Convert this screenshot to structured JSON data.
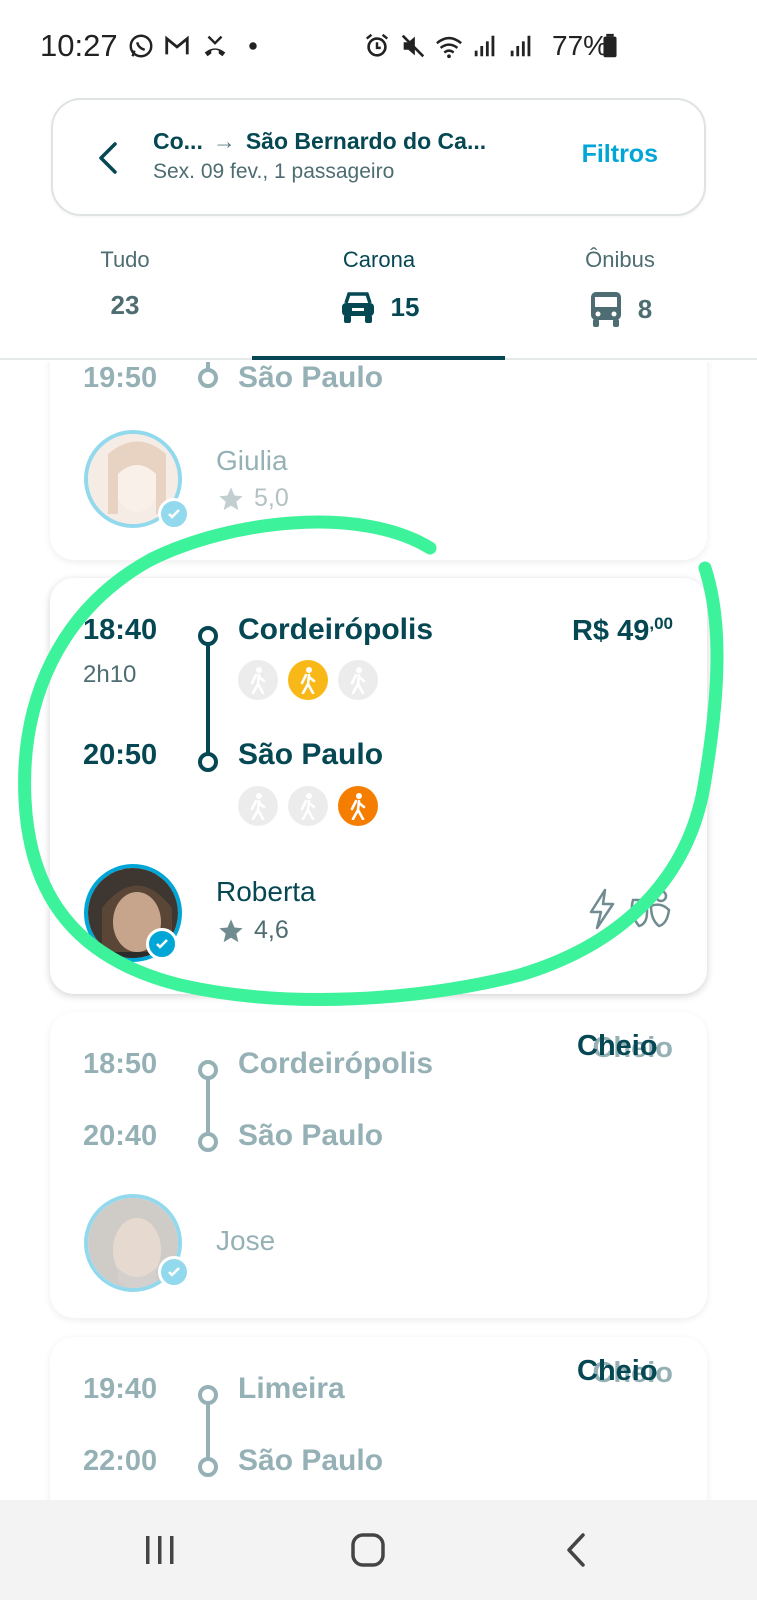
{
  "status_bar": {
    "time": "10:27",
    "battery": "77%",
    "icons": [
      "whatsapp-icon",
      "gmail-icon",
      "missed-call-icon",
      "notification-dot-icon",
      "alarm-icon",
      "mute-icon",
      "wifi-icon",
      "signal-icon",
      "signal-icon",
      "battery-icon"
    ]
  },
  "search": {
    "origin": "Co...",
    "destination": "São Bernardo do Ca...",
    "subtitle": "Sex. 09 fev., 1 passageiro",
    "filters_label": "Filtros"
  },
  "tabs": [
    {
      "label": "Tudo",
      "count": "23",
      "icon": ""
    },
    {
      "label": "Carona",
      "count": "15",
      "icon": "car-icon",
      "active": true
    },
    {
      "label": "Ônibus",
      "count": "8",
      "icon": "bus-icon"
    }
  ],
  "rides": [
    {
      "arrival_time": "19:50",
      "arrival_city": "São Paulo",
      "driver": "Giulia",
      "rating": "5,0",
      "status": "faded"
    },
    {
      "departure_time": "18:40",
      "duration": "2h10",
      "departure_city": "Cordeirópolis",
      "arrival_time": "20:50",
      "arrival_city": "São Paulo",
      "price_main": "R$ 49",
      "price_cents": ",00",
      "driver": "Roberta",
      "rating": "4,6",
      "features": [
        "instant-booking-icon",
        "max-two-back-icon"
      ],
      "highlight_color": "#3cf29a"
    },
    {
      "departure_time": "18:50",
      "departure_city": "Cordeirópolis",
      "arrival_time": "20:40",
      "arrival_city": "São Paulo",
      "driver": "Jose",
      "status_label": "Cheio"
    },
    {
      "departure_time": "19:40",
      "departure_city": "Limeira",
      "arrival_time": "22:00",
      "arrival_city": "São Paulo",
      "status_label": "Cheio"
    }
  ],
  "colors": {
    "primary": "#054752",
    "accent": "#00a6d6",
    "highlight": "#3cf29a",
    "pickup_yellow": "#f8b818",
    "dropoff_orange": "#f57d00"
  }
}
